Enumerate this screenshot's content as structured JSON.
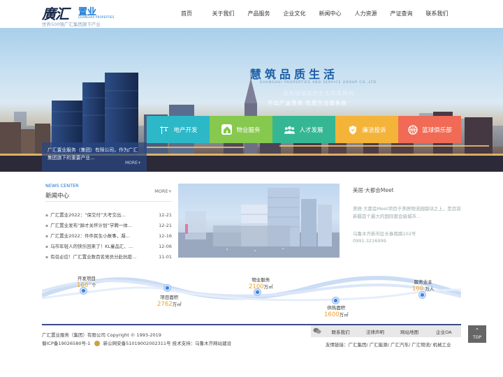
{
  "header": {
    "logo_mark": "廣汇",
    "logo_brand": "置业",
    "logo_en": "GUANGHUI PROPERTIES",
    "logo_sub": "世界500强广汇集团旗下产业",
    "nav": [
      "首页",
      "关于我们",
      "产品服务",
      "企业文化",
      "新闻中心",
      "人力资源",
      "产证查询",
      "联系我们"
    ]
  },
  "banner": {
    "slogan": "慧筑品质生活",
    "slogan_en": "GUANGHUI PROPERTIES AND SERVICE GROUP CO.,LTD",
    "slogan_2": "成为城镇居民全生命周期的",
    "slogan_3": "不动产运营商  优质生活服务商",
    "intro": "广汇置业服务（集团）有限公司，作为广汇集团旗下的重要产业...",
    "intro_more": "MORE+",
    "quick_links": [
      {
        "label": "地产开发",
        "icon": "crane-icon"
      },
      {
        "label": "物业服务",
        "icon": "house-icon"
      },
      {
        "label": "人才发展",
        "icon": "people-icon"
      },
      {
        "label": "廉洁投诉",
        "icon": "shield-icon"
      },
      {
        "label": "篮球俱乐部",
        "icon": "basketball-icon"
      }
    ]
  },
  "news": {
    "title_en": "NEWS CENTER",
    "title_cn": "新闻中心",
    "more": "MORE+",
    "items": [
      {
        "title": "广汇置业2022：“保交付”大考交出...",
        "date": "12-21"
      },
      {
        "title": "广汇置业发布“踔才关怀计划”学聘一体...",
        "date": "12-21"
      },
      {
        "title": "广汇置业2022：件件民生小故事，凝...",
        "date": "12-16"
      },
      {
        "title": "乌市年轻人的快乐回来了！KL童品汇、...",
        "date": "12-06"
      },
      {
        "title": "有召必应！广汇置业数百名党员分赴抗疫...",
        "date": "11-01"
      }
    ]
  },
  "meet": {
    "title": "美居·大都会Meet",
    "desc": "美居·大都会Meet项目于美居物流园版块之上，是目前新疆首个最大的国际都会級城市...",
    "addr": "乌鲁木齐新市区长春南路102号",
    "phone": "0991-3216999"
  },
  "stats": [
    {
      "label": "开发项目",
      "value": "160",
      "unit": "个",
      "sup": "+"
    },
    {
      "label": "项目面积",
      "value": "2762",
      "unit": "万㎡",
      "sup": ""
    },
    {
      "label": "物业服务",
      "value": "2100",
      "unit": "万㎡",
      "sup": ""
    },
    {
      "label": "供热面积",
      "value": "1600",
      "unit": "万㎡",
      "sup": ""
    },
    {
      "label": "服务业主",
      "value": "100",
      "unit": "万人",
      "sup": ""
    }
  ],
  "footer": {
    "company": "广汇置业服务（集团）有限公司 Copyright © 1993-2019",
    "icp": "蜀ICP备19026580号-1",
    "police": "新公网安备51019002002311号",
    "support": "技术支持：乌鲁木齐网站建设",
    "links": [
      "联系我们",
      "法律声明",
      "网站地图",
      "企业OA"
    ],
    "friends": "友情链接：广汇集团/ 广汇能源/ 广汇汽车/ 广汇物流/ 机械工业",
    "top": "TOP"
  },
  "colors": {
    "accent_blue": "#1a6fd0",
    "stat_orange": "#f0a020",
    "q_teal": "#2db8c8",
    "q_green": "#86c94e",
    "q_mint": "#35b794",
    "q_yellow": "#f4b43a",
    "q_red": "#f06a55"
  }
}
